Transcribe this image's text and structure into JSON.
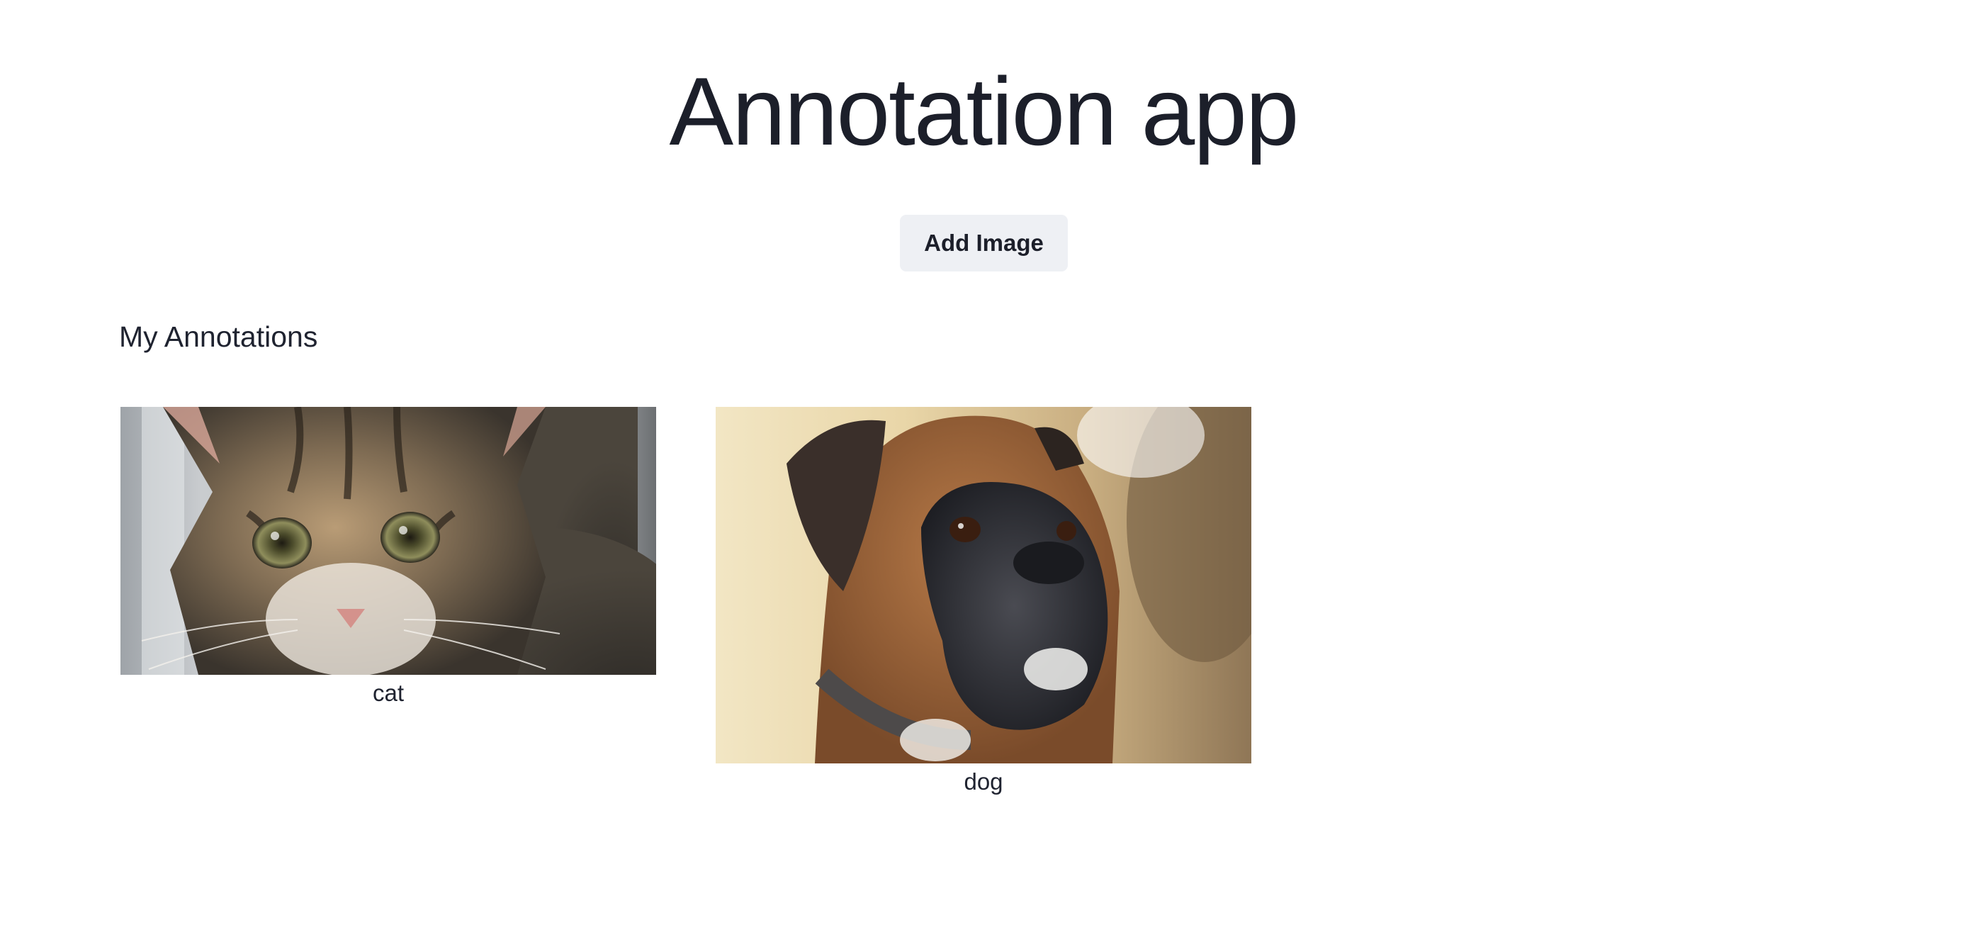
{
  "header": {
    "title": "Annotation app"
  },
  "toolbar": {
    "add_image_label": "Add Image"
  },
  "annotations": {
    "section_title": "My Annotations",
    "items": [
      {
        "label": "cat",
        "image": "kitten-photo"
      },
      {
        "label": "dog",
        "image": "boxer-dog-photo"
      }
    ]
  }
}
